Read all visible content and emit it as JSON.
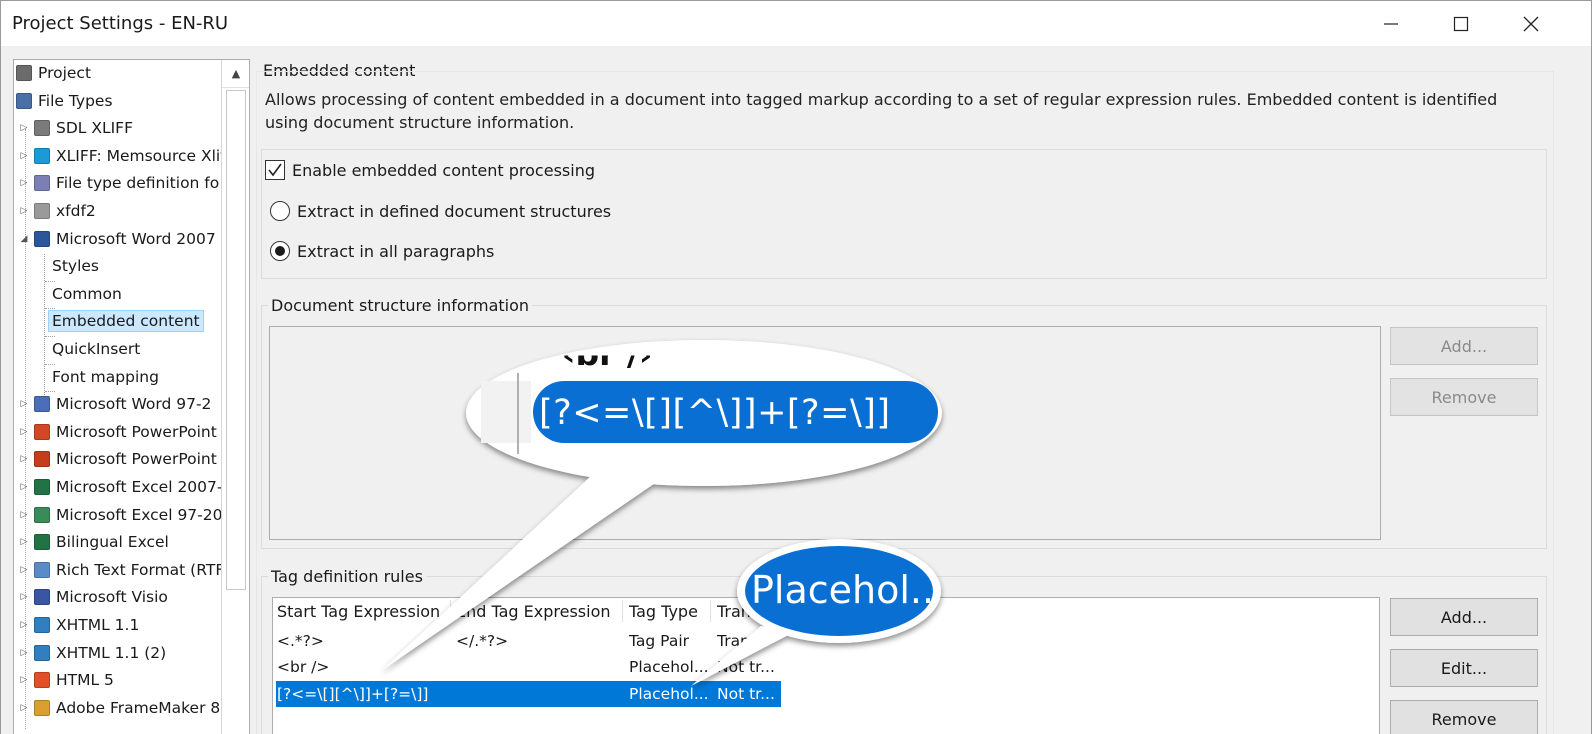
{
  "window": {
    "title": "Project Settings - EN-RU",
    "minimize_glyph": "—",
    "maximize_glyph": "☐",
    "close_glyph": "✕"
  },
  "tree": {
    "items": [
      {
        "label": "Project",
        "icon": "project-icon",
        "level": 0,
        "expander": ""
      },
      {
        "label": "File Types",
        "icon": "file-types-icon",
        "level": 0,
        "expander": ""
      },
      {
        "label": "SDL XLIFF",
        "icon": "xliff-doc-icon",
        "level": 1,
        "expander": "▷"
      },
      {
        "label": "XLIFF: Memsource Xlif",
        "icon": "memsource-icon",
        "level": 1,
        "expander": "▷"
      },
      {
        "label": "File type definition fo",
        "icon": "definition-icon",
        "level": 1,
        "expander": "▷"
      },
      {
        "label": "xfdf2",
        "icon": "code-file-icon",
        "level": 1,
        "expander": "▷"
      },
      {
        "label": "Microsoft Word 2007",
        "icon": "word-icon",
        "level": 1,
        "expander": "◢"
      },
      {
        "label": "Styles",
        "icon": "",
        "level": 2,
        "expander": ""
      },
      {
        "label": "Common",
        "icon": "",
        "level": 2,
        "expander": ""
      },
      {
        "label": "Embedded content",
        "icon": "",
        "level": 2,
        "expander": "",
        "selected": true
      },
      {
        "label": "QuickInsert",
        "icon": "",
        "level": 2,
        "expander": ""
      },
      {
        "label": "Font mapping",
        "icon": "",
        "level": 2,
        "expander": ""
      },
      {
        "label": "Microsoft Word 97-2",
        "icon": "word-legacy-icon",
        "level": 1,
        "expander": "▷"
      },
      {
        "label": "Microsoft PowerPoint",
        "icon": "powerpoint-icon",
        "level": 1,
        "expander": "▷"
      },
      {
        "label": "Microsoft PowerPoint",
        "icon": "powerpoint-legacy-icon",
        "level": 1,
        "expander": "▷"
      },
      {
        "label": "Microsoft Excel 2007-",
        "icon": "excel-icon",
        "level": 1,
        "expander": "▷"
      },
      {
        "label": "Microsoft Excel 97-20",
        "icon": "excel-legacy-icon",
        "level": 1,
        "expander": "▷"
      },
      {
        "label": "Bilingual Excel",
        "icon": "bilingual-excel-icon",
        "level": 1,
        "expander": "▷"
      },
      {
        "label": "Rich Text Format (RTF",
        "icon": "rtf-icon",
        "level": 1,
        "expander": "▷"
      },
      {
        "label": "Microsoft Visio",
        "icon": "visio-icon",
        "level": 1,
        "expander": "▷"
      },
      {
        "label": "XHTML 1.1",
        "icon": "xhtml-icon",
        "level": 1,
        "expander": "▷"
      },
      {
        "label": "XHTML 1.1 (2)",
        "icon": "xhtml-icon",
        "level": 1,
        "expander": "▷"
      },
      {
        "label": "HTML 5",
        "icon": "html5-icon",
        "level": 1,
        "expander": "▷"
      },
      {
        "label": "Adobe FrameMaker 8",
        "icon": "framemaker-icon",
        "level": 1,
        "expander": "▷"
      }
    ],
    "scroll_up_glyph": "▲"
  },
  "embedded": {
    "group_title": "Embedded content",
    "description": "Allows processing of content embedded in a document into tagged markup according to a set of regular expression rules. Embedded content is identified using document structure information.",
    "enable_label": "Enable embedded content processing",
    "enable_checked": true,
    "check_glyph": "✓",
    "radio_defined": "Extract in defined document structures",
    "radio_all": "Extract in all paragraphs",
    "selected_radio": "all"
  },
  "doc_structure": {
    "group_title": "Document structure information",
    "add_button": "Add...",
    "remove_button": "Remove"
  },
  "tag_rules": {
    "group_title": "Tag definition rules",
    "columns": [
      "Start Tag Expression",
      "End Tag Expression",
      "Tag Type",
      "Tran"
    ],
    "rows": [
      {
        "start": "<.*?>",
        "end": "</.*?>",
        "type": "Tag Pair",
        "trans": "Tran..."
      },
      {
        "start": "<br />",
        "end": "",
        "type": "Placehol...",
        "trans": "Not tr..."
      },
      {
        "start": "[?<=\\[][^\\]]+[?=\\]]",
        "end": "",
        "type": "Placehol...",
        "trans": "Not tr...",
        "selected": true
      }
    ],
    "add_button": "Add...",
    "edit_button": "Edit...",
    "remove_button": "Remove"
  },
  "callouts": {
    "zoom_regex": "[?<=\\[][^\\]]+[?=\\]]",
    "zoom_above": "‹br /›",
    "zoom_placeholder": "Placehol.."
  },
  "colors": {
    "selection_blue": "#0078d7",
    "tree_selection": "#cce8ff",
    "dialog_bg": "#f0f0f0"
  }
}
